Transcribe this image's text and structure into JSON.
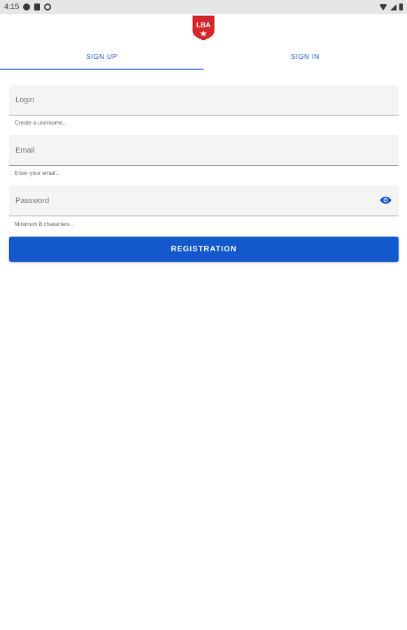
{
  "status_bar": {
    "time": "4:15"
  },
  "logo": {
    "text": "LBA",
    "color": "#d9262b"
  },
  "tabs": [
    {
      "label": "SIGN UP",
      "active": true
    },
    {
      "label": "SIGN IN",
      "active": false
    }
  ],
  "form": {
    "login": {
      "placeholder": "Login",
      "helper": "Create a username..."
    },
    "email": {
      "placeholder": "Email",
      "helper": "Enter your email..."
    },
    "password": {
      "placeholder": "Password",
      "helper": "Minimum 8 characters..."
    },
    "submit_label": "REGISTRATION"
  },
  "colors": {
    "accent": "#1459cc",
    "tab_text": "#1a5fd0",
    "field_bg": "#f4f4f4"
  }
}
